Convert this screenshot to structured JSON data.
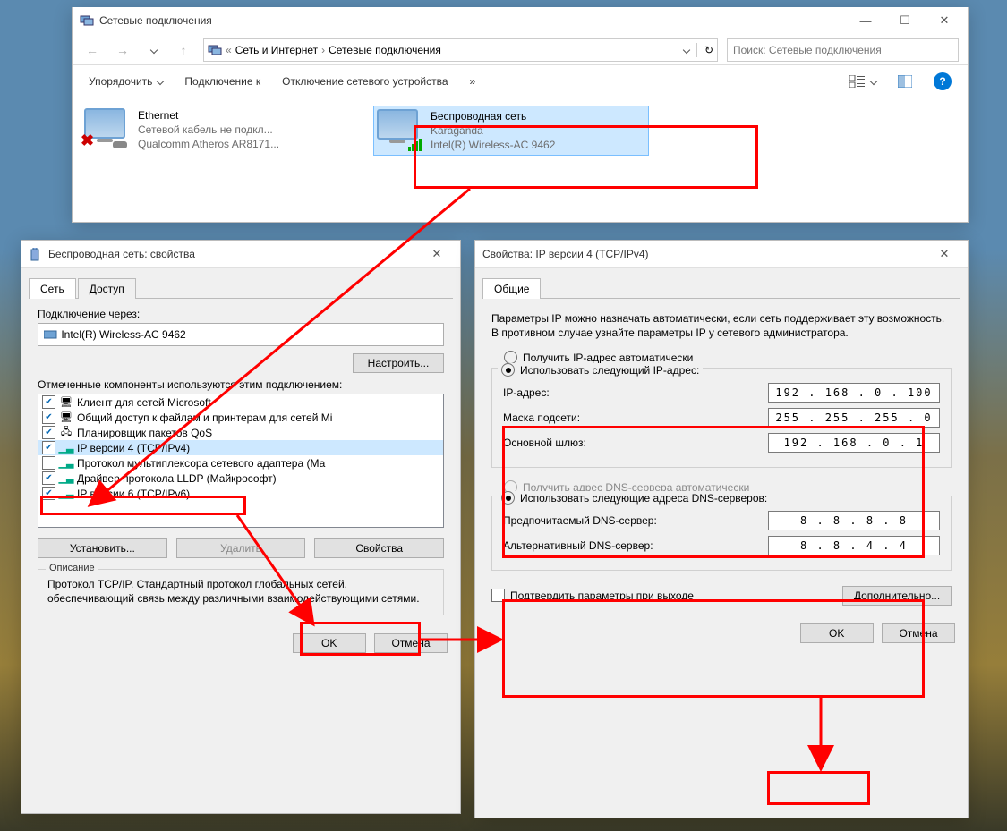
{
  "explorer": {
    "title": "Сетевые подключения",
    "crumb_sep": "«",
    "crumb1": "Сеть и Интернет",
    "crumb2": "Сетевые подключения",
    "search_ph": "Поиск: Сетевые подключения",
    "tb_organize": "Упорядочить",
    "tb_connect": "Подключение к",
    "tb_disable": "Отключение сетевого устройства",
    "tb_more": "»",
    "adapters": [
      {
        "name": "Ethernet",
        "sub1": "Сетевой кабель не подкл...",
        "sub2": "Qualcomm Atheros AR8171..."
      },
      {
        "name": "Беспроводная сеть",
        "sub1": "Karaganda",
        "sub2": "Intel(R) Wireless-AC 9462"
      }
    ]
  },
  "dlg1": {
    "title": "Беспроводная сеть: свойства",
    "tab1": "Сеть",
    "tab2": "Доступ",
    "conn_via": "Подключение через:",
    "adapter": "Intel(R) Wireless-AC 9462",
    "configure": "Настроить...",
    "components_label": "Отмеченные компоненты используются этим подключением:",
    "items": [
      "Клиент для сетей Microsoft",
      "Общий доступ к файлам и принтерам для сетей Mi",
      "Планировщик пакетов QoS",
      "IP версии 4 (TCP/IPv4)",
      "Протокол мультиплексора сетевого адаптера (Ма",
      "Драйвер протокола LLDP (Майкрософт)",
      "IP версии 6 (TCP/IPv6)"
    ],
    "install": "Установить...",
    "remove": "Удалить",
    "props": "Свойства",
    "desc_title": "Описание",
    "desc": "Протокол TCP/IP. Стандартный протокол глобальных сетей, обеспечивающий связь между различными взаимодействующими сетями.",
    "ok": "OK",
    "cancel": "Отмена"
  },
  "dlg2": {
    "title": "Свойства: IP версии 4 (TCP/IPv4)",
    "tab1": "Общие",
    "help": "Параметры IP можно назначать автоматически, если сеть поддерживает эту возможность. В противном случае узнайте параметры IP у сетевого администратора.",
    "r_auto_ip": "Получить IP-адрес автоматически",
    "r_man_ip": "Использовать следующий IP-адрес:",
    "ip_label": "IP-адрес:",
    "ip_val": "192 . 168 .  0  . 100",
    "mask_label": "Маска подсети:",
    "mask_val": "255 . 255 . 255 .  0",
    "gw_label": "Основной шлюз:",
    "gw_val": "192 . 168 .  0  .  1",
    "r_auto_dns": "Получить адрес DNS-сервера автоматически",
    "r_man_dns": "Использовать следующие адреса DNS-серверов:",
    "dns1_label": "Предпочитаемый DNS-сервер:",
    "dns1_val": "8  .  8  .  8  .  8",
    "dns2_label": "Альтернативный DNS-сервер:",
    "dns2_val": "8  .  8  .  4  .  4",
    "confirm": "Подтвердить параметры при выходе",
    "adv": "Дополнительно...",
    "ok": "OK",
    "cancel": "Отмена"
  }
}
